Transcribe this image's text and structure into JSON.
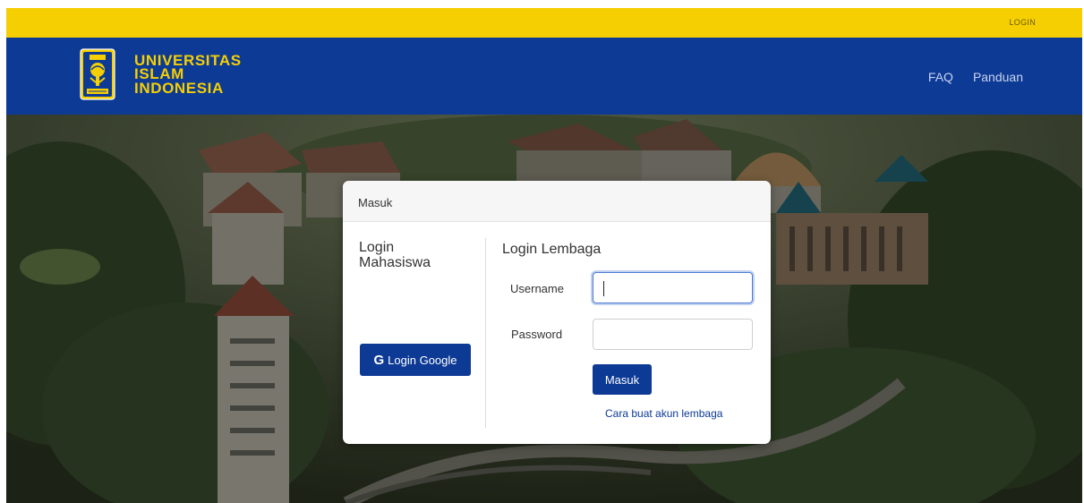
{
  "topbar": {
    "login_label": "LOGIN"
  },
  "brand": {
    "line1": "UNIVERSITAS",
    "line2": "ISLAM",
    "line3": "INDONESIA"
  },
  "nav": {
    "items": [
      {
        "label": "FAQ"
      },
      {
        "label": "Panduan"
      }
    ]
  },
  "login_card": {
    "header": "Masuk",
    "student": {
      "title": "Login Mahasiswa",
      "google_button": {
        "icon_letter": "G",
        "label": "Login Google"
      }
    },
    "institution": {
      "title": "Login Lembaga",
      "username_label": "Username",
      "username_value": "",
      "password_label": "Password",
      "password_value": "",
      "submit_label": "Masuk",
      "help_link": "Cara buat akun lembaga"
    }
  },
  "colors": {
    "topbar": "#f5cf02",
    "navbar": "#0d3a95",
    "brand_text": "#f5cf02",
    "button": "#0d3a95"
  },
  "icons": [
    "uii-logo-icon",
    "google-g-icon"
  ]
}
